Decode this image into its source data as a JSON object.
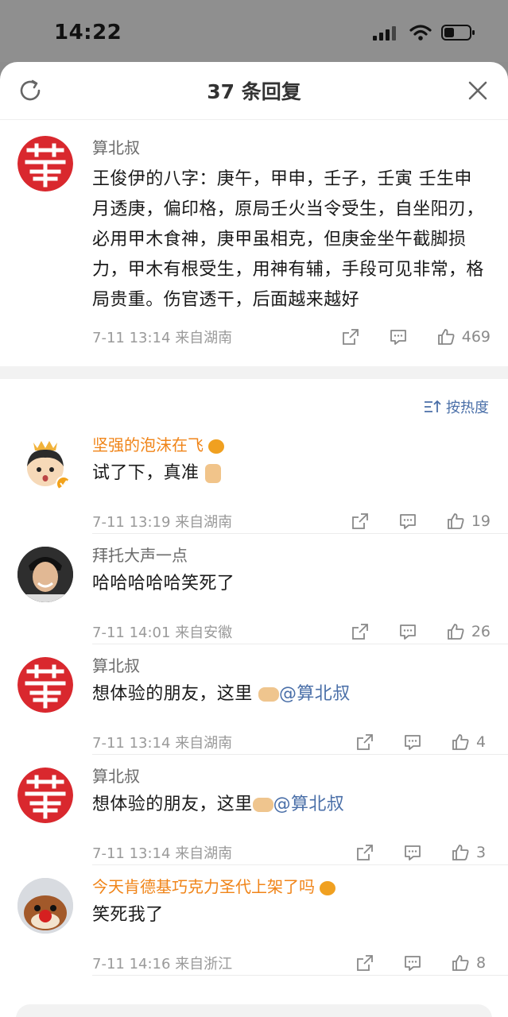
{
  "status": {
    "time": "14:22"
  },
  "header": {
    "title": "37 条回复"
  },
  "main_comment": {
    "username": "算北叔",
    "text": "王俊伊的八字：庚午，甲申，壬子，壬寅 壬生申月透庚，偏印格，原局壬火当令受生，自坐阳刃，必用甲木食神，庚甲虽相克，但庚金坐午截脚损力，甲木有根受生，用神有辅，手段可见非常，格局贵重。伤官透干，后面越来越好",
    "date": "7-11 13:14",
    "location": "来自湖南",
    "likes": "469"
  },
  "sort": {
    "label": "按热度"
  },
  "replies": [
    {
      "username": "坚强的泡沫在飞",
      "text": "试了下，真准",
      "date": "7-11 13:19",
      "location": "来自湖南",
      "likes": "19"
    },
    {
      "username": "拜托大声一点",
      "text": "哈哈哈哈哈笑死了",
      "date": "7-11 14:01",
      "location": "来自安徽",
      "likes": "26"
    },
    {
      "username": "算北叔",
      "text": "想体验的朋友，这里 ",
      "mention": "@算北叔",
      "date": "7-11 13:14",
      "location": "来自湖南",
      "likes": "4"
    },
    {
      "username": "算北叔",
      "text": "想体验的朋友，这里",
      "mention": "@算北叔",
      "date": "7-11 13:14",
      "location": "来自湖南",
      "likes": "3"
    },
    {
      "username": "今天肯德基巧克力圣代上架了吗",
      "text": "笑死我了",
      "date": "7-11 14:16",
      "location": "来自浙江",
      "likes": "8"
    }
  ],
  "colors": {
    "accent": "#4a6fa8",
    "vip_name": "#f08418",
    "logo_red": "#d9282e"
  },
  "icons": [
    "refresh-icon",
    "close-icon",
    "share-icon",
    "comment-icon",
    "like-icon",
    "sort-icon",
    "signal-icon",
    "wifi-icon",
    "battery-icon"
  ]
}
